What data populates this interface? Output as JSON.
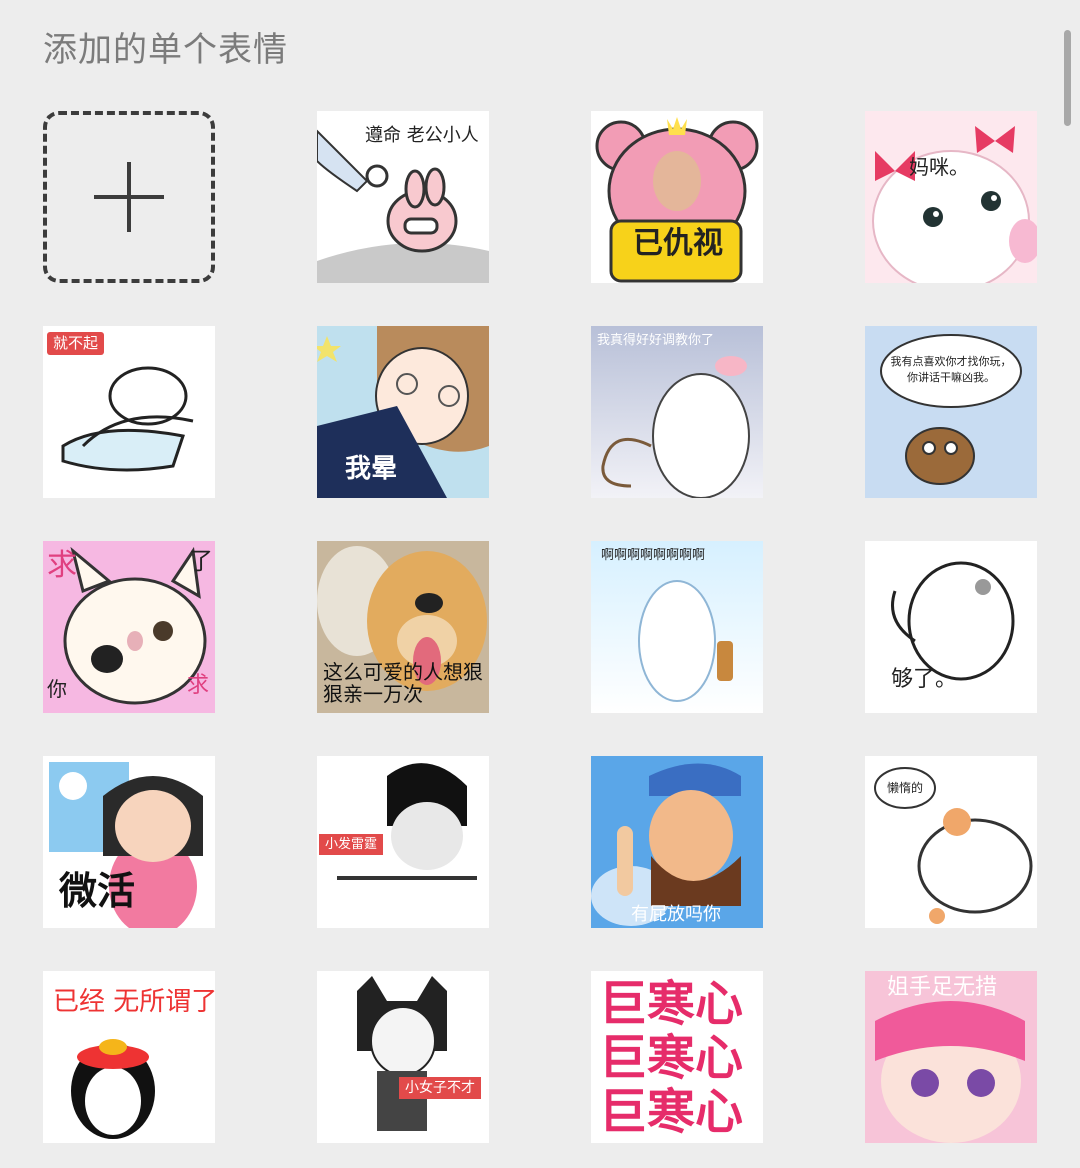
{
  "page": {
    "section_title": "添加的单个表情"
  },
  "colors": {
    "background": "#ededed",
    "title": "#7b7b7b",
    "scrollbar": "#a8a8a8"
  },
  "add_tile": {
    "icon": "plus-icon"
  },
  "stickers": [
    {
      "text": "遵命 老公小人"
    },
    {
      "text": "已仇视"
    },
    {
      "text": "妈咪。"
    },
    {
      "text": "就不起"
    },
    {
      "text": "我晕"
    },
    {
      "text": "我真得好好调教你了"
    },
    {
      "text": "我有点喜欢你才找你玩，你讲话干嘛凶我。"
    },
    {
      "text_left": "求",
      "text_right": "了",
      "text_bottom_left": "你",
      "text_bottom_right": "求"
    },
    {
      "text": "这么可爱的人想狠狠亲一万次"
    },
    {
      "text": "啊啊啊啊啊啊啊啊"
    },
    {
      "text": "够了。"
    },
    {
      "text": "微活"
    },
    {
      "text": "小发雷霆"
    },
    {
      "text": "有屁放吗你"
    },
    {
      "text": "懒惰的"
    },
    {
      "text": "已经 无所谓了"
    },
    {
      "text": "小女子不才"
    },
    {
      "text": "巨寒心巨寒心巨寒心"
    },
    {
      "text": "姐手足无措"
    }
  ]
}
